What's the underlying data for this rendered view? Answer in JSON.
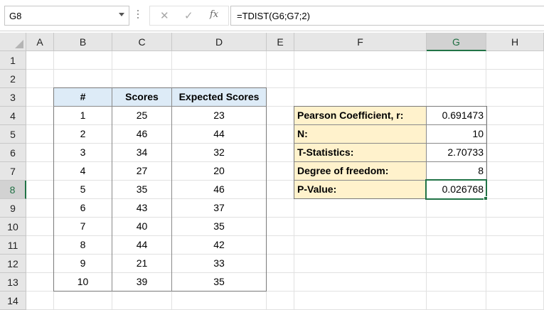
{
  "formula_bar": {
    "name_box": "G8",
    "cancel_icon": "✕",
    "enter_icon": "✓",
    "fx_icon": "fx",
    "formula": "=TDIST(G6;G7;2)"
  },
  "columns": [
    "A",
    "B",
    "C",
    "D",
    "E",
    "F",
    "G",
    "H"
  ],
  "rows": [
    "1",
    "2",
    "3",
    "4",
    "5",
    "6",
    "7",
    "8",
    "9",
    "10",
    "11",
    "12",
    "13",
    "14"
  ],
  "selected_cell": {
    "column": "G",
    "row": "8"
  },
  "scores_table": {
    "headers": [
      "#",
      "Scores",
      "Expected Scores"
    ],
    "rows": [
      [
        "1",
        "25",
        "23"
      ],
      [
        "2",
        "46",
        "44"
      ],
      [
        "3",
        "34",
        "32"
      ],
      [
        "4",
        "27",
        "20"
      ],
      [
        "5",
        "35",
        "46"
      ],
      [
        "6",
        "43",
        "37"
      ],
      [
        "7",
        "40",
        "35"
      ],
      [
        "8",
        "44",
        "42"
      ],
      [
        "9",
        "21",
        "33"
      ],
      [
        "10",
        "39",
        "35"
      ]
    ]
  },
  "stats_table": {
    "rows": [
      {
        "label": "Pearson Coefficient, r:",
        "value": "0.691473"
      },
      {
        "label": "N:",
        "value": "10"
      },
      {
        "label": "T-Statistics:",
        "value": "2.70733"
      },
      {
        "label": "Degree of freedom:",
        "value": "8"
      },
      {
        "label": "P-Value:",
        "value": "0.026768"
      }
    ]
  },
  "colors": {
    "header_fill": "#ddebf7",
    "stats_fill": "#fff2cc",
    "selection": "#217346"
  }
}
